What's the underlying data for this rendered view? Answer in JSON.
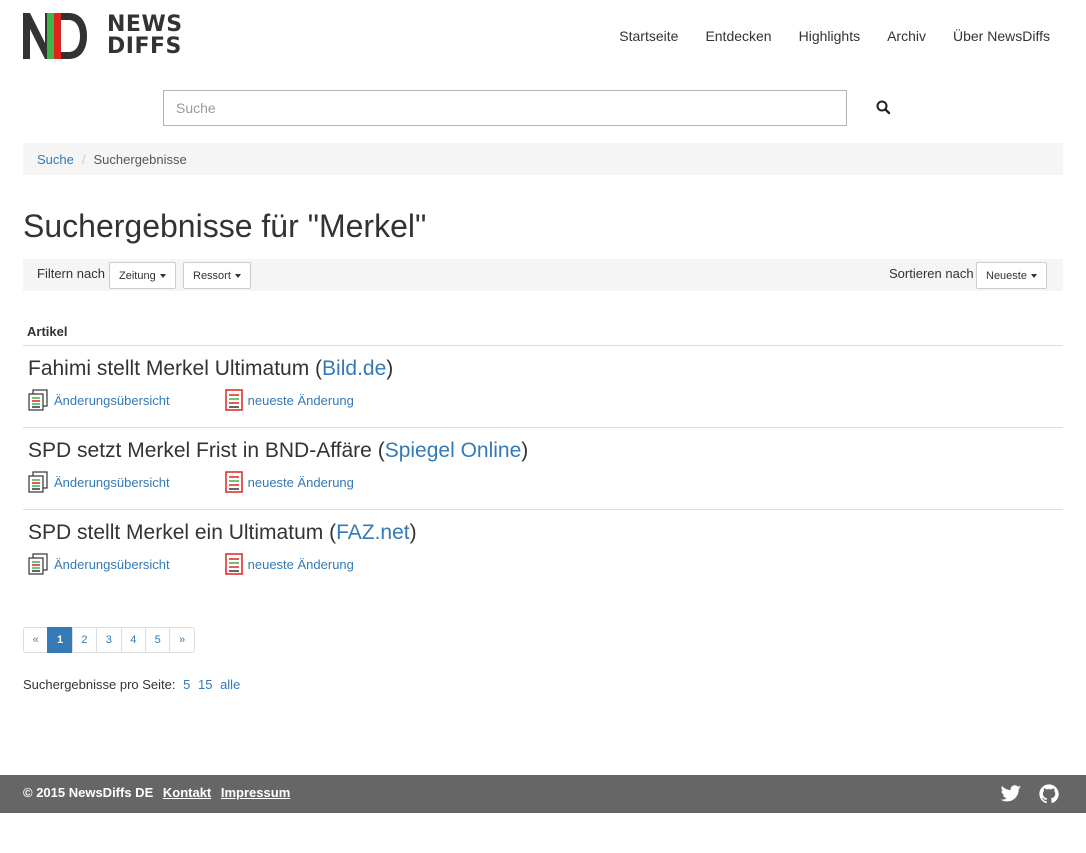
{
  "header": {
    "logo_text_line1": "NEWS",
    "logo_text_line2": "DIFFS",
    "nav": [
      "Startseite",
      "Entdecken",
      "Highlights",
      "Archiv",
      "Über NewsDiffs"
    ]
  },
  "search": {
    "placeholder": "Suche",
    "value": ""
  },
  "breadcrumb": {
    "root": "Suche",
    "current": "Suchergebnisse"
  },
  "page_title": "Suchergebnisse für \"Merkel\"",
  "filter": {
    "label": "Filtern nach",
    "newspaper": "Zeitung",
    "section": "Ressort",
    "sort_label": "Sortieren nach",
    "sort_value": "Neueste"
  },
  "table": {
    "column_header": "Artikel"
  },
  "articles": [
    {
      "title": "Fahimi stellt Merkel Ultimatum",
      "source": "Bild.de",
      "overview_label": "Änderungsübersicht",
      "latest_label": "neueste Änderung"
    },
    {
      "title": "SPD setzt Merkel Frist in BND-Affäre",
      "source": "Spiegel Online",
      "overview_label": "Änderungsübersicht",
      "latest_label": "neueste Änderung"
    },
    {
      "title": "SPD stellt Merkel ein Ultimatum",
      "source": "FAZ.net",
      "overview_label": "Änderungsübersicht",
      "latest_label": "neueste Änderung"
    }
  ],
  "pagination": {
    "prev": "«",
    "pages": [
      "1",
      "2",
      "3",
      "4",
      "5"
    ],
    "current": "1",
    "next": "»"
  },
  "per_page": {
    "label": "Suchergebnisse pro Seite:",
    "options": [
      "5",
      "15",
      "alle"
    ]
  },
  "footer": {
    "copyright": "© 2015 NewsDiffs DE",
    "links": [
      "Kontakt",
      "Impressum"
    ],
    "icons": [
      "twitter-icon",
      "github-icon"
    ]
  },
  "colors": {
    "link": "#337ab7",
    "footer_bg": "#666666",
    "logo_red": "#e0231d",
    "logo_green": "#3eb44a"
  }
}
